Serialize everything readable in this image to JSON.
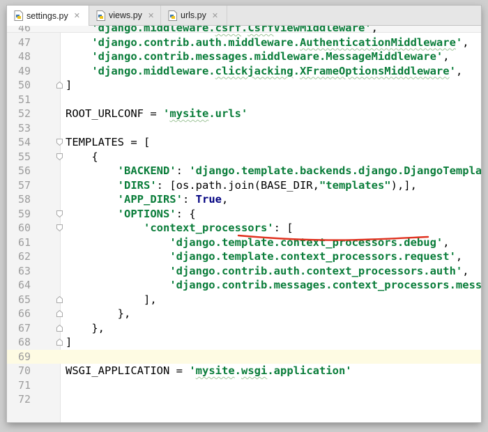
{
  "tabs": [
    {
      "label": "settings.py",
      "active": true
    },
    {
      "label": "views.py",
      "active": false
    },
    {
      "label": "urls.py",
      "active": false
    }
  ],
  "colors": {
    "string": "#0a7d3a",
    "keyword": "#000080",
    "line_number": "#9c9c9c",
    "annotation": "#e0301e",
    "caret_line": "#fefbe3"
  },
  "lines": [
    {
      "num": "46",
      "text": "    'django.middleware.csrf.CsrfViewMiddleware',"
    },
    {
      "num": "47",
      "text": "    'django.contrib.auth.middleware.AuthenticationMiddleware',"
    },
    {
      "num": "48",
      "text": "    'django.contrib.messages.middleware.MessageMiddleware',"
    },
    {
      "num": "49",
      "text": "    'django.middleware.clickjacking.XFrameOptionsMiddleware',"
    },
    {
      "num": "50",
      "text": "]"
    },
    {
      "num": "51",
      "text": ""
    },
    {
      "num": "52",
      "text": "ROOT_URLCONF = 'mysite.urls'"
    },
    {
      "num": "53",
      "text": ""
    },
    {
      "num": "54",
      "text": "TEMPLATES = ["
    },
    {
      "num": "55",
      "text": "    {"
    },
    {
      "num": "56",
      "text": "        'BACKEND': 'django.template.backends.django.DjangoTemplates',"
    },
    {
      "num": "57",
      "text": "        'DIRS': [os.path.join(BASE_DIR,\"templates\"),],"
    },
    {
      "num": "58",
      "text": "        'APP_DIRS': True,"
    },
    {
      "num": "59",
      "text": "        'OPTIONS': {"
    },
    {
      "num": "60",
      "text": "            'context_processors': ["
    },
    {
      "num": "61",
      "text": "                'django.template.context_processors.debug',"
    },
    {
      "num": "62",
      "text": "                'django.template.context_processors.request',"
    },
    {
      "num": "63",
      "text": "                'django.contrib.auth.context_processors.auth',"
    },
    {
      "num": "64",
      "text": "                'django.contrib.messages.context_processors.messages',"
    },
    {
      "num": "65",
      "text": "            ],"
    },
    {
      "num": "66",
      "text": "        },"
    },
    {
      "num": "67",
      "text": "    },"
    },
    {
      "num": "68",
      "text": "]"
    },
    {
      "num": "69",
      "text": ""
    },
    {
      "num": "70",
      "text": "WSGI_APPLICATION = 'mysite.wsgi.application'"
    },
    {
      "num": "71",
      "text": ""
    },
    {
      "num": "72",
      "text": ""
    }
  ]
}
